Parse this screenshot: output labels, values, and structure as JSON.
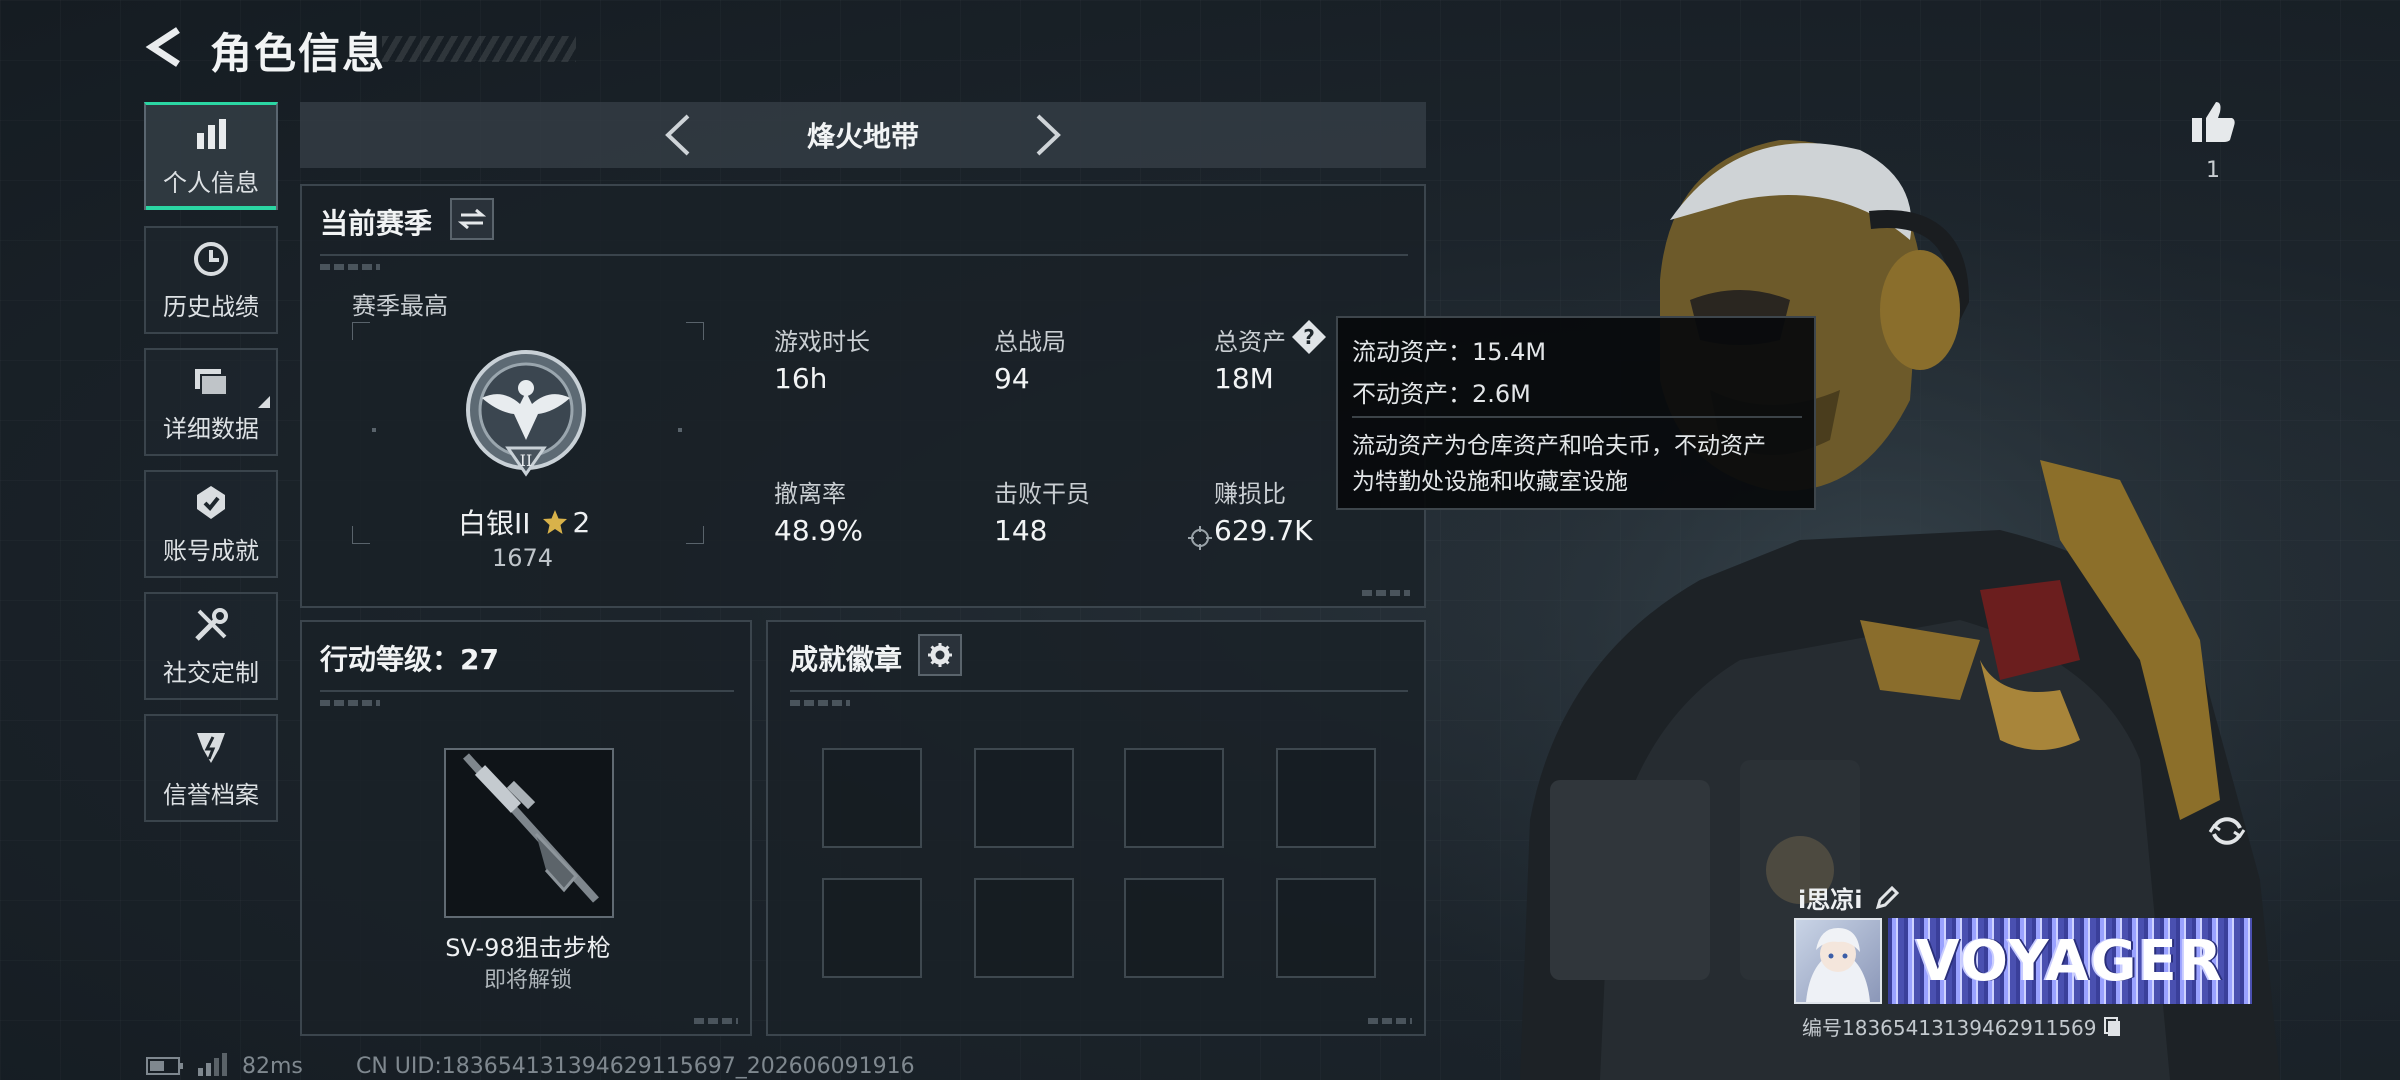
{
  "header": {
    "title": "角色信息"
  },
  "sidebar": {
    "items": [
      {
        "label": "个人信息",
        "icon": "bar-chart-icon",
        "active": true
      },
      {
        "label": "历史战绩",
        "icon": "history-clock-icon"
      },
      {
        "label": "详细数据",
        "icon": "folder-data-icon"
      },
      {
        "label": "账号成就",
        "icon": "achievement-icon"
      },
      {
        "label": "社交定制",
        "icon": "wrench-screwdriver-icon"
      },
      {
        "label": "信誉档案",
        "icon": "reputation-icon"
      }
    ]
  },
  "mode_selector": {
    "label": "烽火地带"
  },
  "season": {
    "title": "当前赛季",
    "best_label": "赛季最高",
    "rank_name": "白银II",
    "rank_stars": "2",
    "rank_score": "1674",
    "stats": [
      {
        "label": "游戏时长",
        "value": "16h"
      },
      {
        "label": "总战局",
        "value": "94"
      },
      {
        "label": "总资产",
        "value": "18M"
      },
      {
        "label": "撤离率",
        "value": "48.9%"
      },
      {
        "label": "击败干员",
        "value": "148"
      },
      {
        "label": "赚损比",
        "value": "629.7K"
      }
    ]
  },
  "tooltip": {
    "liquid": "流动资产：15.4M",
    "fixed": "不动资产：2.6M",
    "desc1": "流动资产为仓库资产和哈夫币，不动资产",
    "desc2": "为特勤处设施和收藏室设施"
  },
  "action_level": {
    "title": "行动等级：27",
    "weapon_name": "SV-98狙击步枪",
    "weapon_status": "即将解锁"
  },
  "badges": {
    "title": "成就徽章"
  },
  "likes": {
    "count": "1"
  },
  "profile": {
    "name": "i思凉i",
    "banner_text": "VOYAGER",
    "id_text": "编号18365413139462911569"
  },
  "footer": {
    "ping": "82ms",
    "uid": "CN UID:183654131394629115697_202606091916"
  },
  "colors": {
    "accent": "#2bd6a3",
    "background": "#1c242b"
  }
}
